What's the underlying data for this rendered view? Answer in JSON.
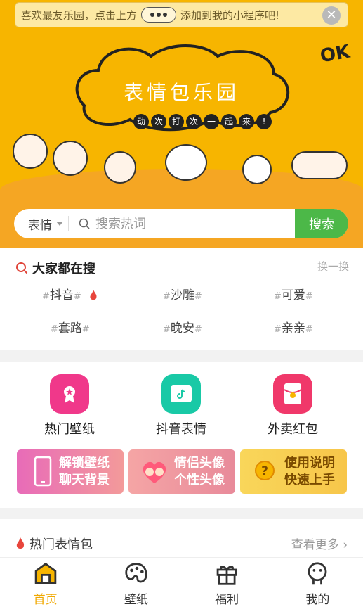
{
  "tip": {
    "text_before": "喜欢最友乐园，点击上方",
    "text_after": "添加到我的小程序吧!",
    "close": "✕"
  },
  "banner": {
    "title": "表情包乐园",
    "slogan": [
      "动",
      "次",
      "打",
      "次",
      "一",
      "起",
      "来",
      "!"
    ],
    "ok": "OK"
  },
  "search": {
    "category": "表情",
    "placeholder": "搜索热词",
    "button": "搜索"
  },
  "hot_search": {
    "title": "大家都在搜",
    "refresh": "换一换",
    "tags": [
      "抖音",
      "沙雕",
      "可爱",
      "套路",
      "晚安",
      "亲亲"
    ]
  },
  "categories": [
    {
      "label": "热门壁纸",
      "icon": "award-icon",
      "color": "#f0388a"
    },
    {
      "label": "抖音表情",
      "icon": "tiktok-icon",
      "color": "#19c9a6"
    },
    {
      "label": "外卖红包",
      "icon": "red-envelope-icon",
      "color": "#f0386a"
    }
  ],
  "promos": [
    {
      "line1": "解锁壁纸",
      "line2": "聊天背景"
    },
    {
      "line1": "情侣头像",
      "line2": "个性头像"
    },
    {
      "line1": "使用说明",
      "line2": "快速上手"
    }
  ],
  "hot_packs": {
    "title": "热门表情包",
    "more": "查看更多"
  },
  "tabs": [
    {
      "label": "首页",
      "icon": "home-icon",
      "active": true
    },
    {
      "label": "壁纸",
      "icon": "palette-icon",
      "active": false
    },
    {
      "label": "福利",
      "icon": "gift-icon",
      "active": false
    },
    {
      "label": "我的",
      "icon": "user-icon",
      "active": false
    }
  ],
  "colors": {
    "brand": "#f7b500",
    "search_button": "#4cb848",
    "accent": "#f0a800"
  }
}
